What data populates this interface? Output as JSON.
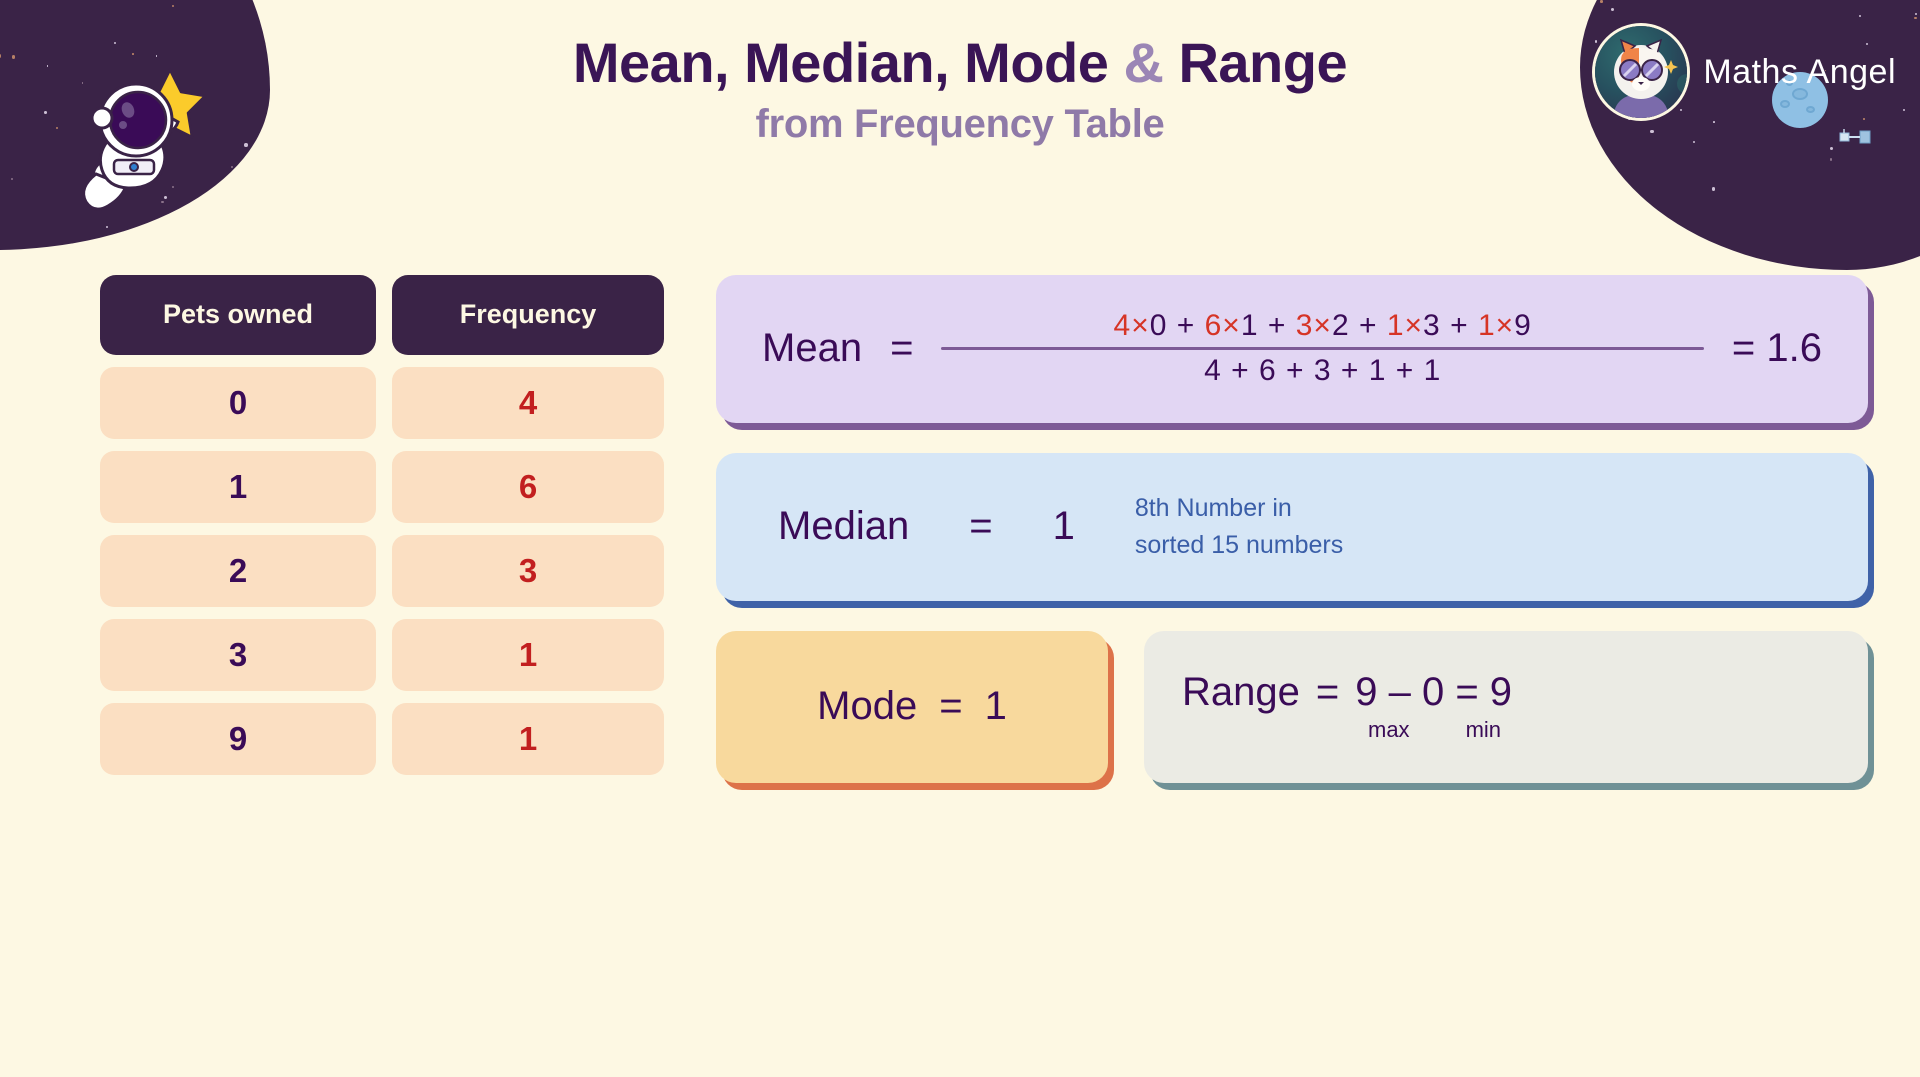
{
  "header": {
    "title_part1": "Mean, Median, Mode ",
    "title_amp": "&",
    "title_part2": " Range",
    "subtitle": "from Frequency Table"
  },
  "brand": {
    "name": "Maths Angel",
    "logo_icon": "fox-astronaut-logo-icon"
  },
  "decorations": {
    "astronaut_icon": "astronaut-with-star-icon",
    "planet_icon": "blue-planet-icon",
    "satellite_icon": "satellite-icon",
    "star_icon": "yellow-star-icon"
  },
  "table": {
    "headers": {
      "value": "Pets owned",
      "frequency": "Frequency"
    },
    "values": [
      "0",
      "1",
      "2",
      "3",
      "9"
    ],
    "frequencies": [
      "4",
      "6",
      "3",
      "1",
      "1"
    ]
  },
  "cards": {
    "mean": {
      "label": "Mean",
      "equals": "=",
      "numerator_terms": [
        {
          "freq": "4",
          "times": "×",
          "value": "0"
        },
        {
          "freq": "6",
          "times": "×",
          "value": "1"
        },
        {
          "freq": "3",
          "times": "×",
          "value": "2"
        },
        {
          "freq": "1",
          "times": "×",
          "value": "3"
        },
        {
          "freq": "1",
          "times": "×",
          "value": "9"
        }
      ],
      "numerator_text": "4 × 0 + 6 × 1 + 3 × 2 + 1 × 3 + 1 × 9",
      "denominator_text": "4 + 6 + 3 + 1 + 1",
      "result": "= 1.6"
    },
    "median": {
      "label": "Median",
      "equals": "=",
      "value": "1",
      "note": "8th Number in\nsorted 15 numbers"
    },
    "mode": {
      "label": "Mode",
      "equals": "=",
      "value": "1"
    },
    "range": {
      "label": "Range",
      "equals": "=",
      "expression": "9 – 0 = 9",
      "max_tag": "max",
      "min_tag": "min"
    }
  },
  "colors": {
    "background": "#fdf8e3",
    "deep_purple": "#3a0b57",
    "header_purple": "#3a2347",
    "accent_red": "#c21f1f",
    "mean_card": "#e2d6f3",
    "median_card": "#d6e6f6",
    "mode_card": "#f8d99d",
    "range_card": "#ebebe4",
    "cell_peach": "#fbdfc2"
  },
  "chart_data": {
    "type": "table",
    "title": "Mean, Median, Mode & Range from Frequency Table",
    "categories": [
      "0",
      "1",
      "2",
      "3",
      "9"
    ],
    "values": [
      4,
      6,
      3,
      1,
      1
    ],
    "xlabel": "Pets owned",
    "ylabel": "Frequency",
    "statistics": {
      "mean": 1.6,
      "median": 1,
      "mode": 1,
      "range": 9,
      "total_frequency": 15,
      "max": 9,
      "min": 0
    }
  }
}
